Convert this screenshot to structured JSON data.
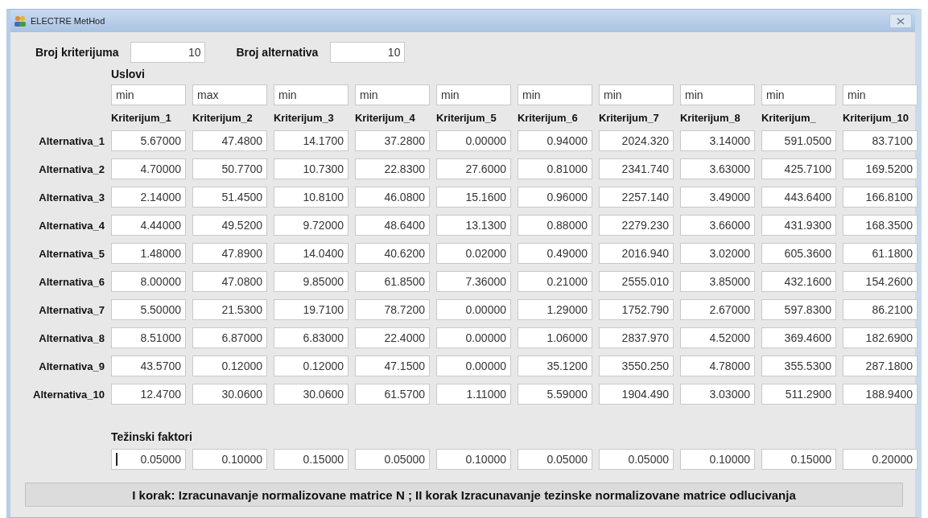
{
  "window": {
    "title": "ELECTRE MetHod"
  },
  "counts": [
    {
      "label": "Broj kriterijuma",
      "value": "10"
    },
    {
      "label": "Broj alternativa",
      "value": "10"
    }
  ],
  "conditions_label": "Uslovi",
  "conditions": [
    "min",
    "max",
    "min",
    "min",
    "min",
    "min",
    "min",
    "min",
    "min",
    "min"
  ],
  "criteria": [
    "Kriterijum_1",
    "Kriterijum_2",
    "Kriterijum_3",
    "Kriterijum_4",
    "Kriterijum_5",
    "Kriterijum_6",
    "Kriterijum_7",
    "Kriterijum_8",
    "Kriterijum_",
    "Kriterijum_10"
  ],
  "rows": [
    {
      "label": "Alternativa_1",
      "values": [
        "5.67000",
        "47.4800",
        "14.1700",
        "37.2800",
        "0.00000",
        "0.94000",
        "2024.320",
        "3.14000",
        "591.0500",
        "83.7100"
      ]
    },
    {
      "label": "Alternativa_2",
      "values": [
        "4.70000",
        "50.7700",
        "10.7300",
        "22.8300",
        "27.6000",
        "0.81000",
        "2341.740",
        "3.63000",
        "425.7100",
        "169.5200"
      ]
    },
    {
      "label": "Alternativa_3",
      "values": [
        "2.14000",
        "51.4500",
        "10.8100",
        "46.0800",
        "15.1600",
        "0.96000",
        "2257.140",
        "3.49000",
        "443.6400",
        "166.8100"
      ]
    },
    {
      "label": "Alternativa_4",
      "values": [
        "4.44000",
        "49.5200",
        "9.72000",
        "48.6400",
        "13.1300",
        "0.88000",
        "2279.230",
        "3.66000",
        "431.9300",
        "168.3500"
      ]
    },
    {
      "label": "Alternativa_5",
      "values": [
        "1.48000",
        "47.8900",
        "14.0400",
        "40.6200",
        "0.02000",
        "0.49000",
        "2016.940",
        "3.02000",
        "605.3600",
        "61.1800"
      ]
    },
    {
      "label": "Alternativa_6",
      "values": [
        "8.00000",
        "47.0800",
        "9.85000",
        "61.8500",
        "7.36000",
        "0.21000",
        "2555.010",
        "3.85000",
        "432.1600",
        "154.2600"
      ]
    },
    {
      "label": "Alternativa_7",
      "values": [
        "5.50000",
        "21.5300",
        "19.7100",
        "78.7200",
        "0.00000",
        "1.29000",
        "1752.790",
        "2.67000",
        "597.8300",
        "86.2100"
      ]
    },
    {
      "label": "Alternativa_8",
      "values": [
        "8.51000",
        "6.87000",
        "6.83000",
        "22.4000",
        "0.00000",
        "1.06000",
        "2837.970",
        "4.52000",
        "369.4600",
        "182.6900"
      ]
    },
    {
      "label": "Alternativa_9",
      "values": [
        "43.5700",
        "0.12000",
        "0.12000",
        "47.1500",
        "0.00000",
        "35.1200",
        "3550.250",
        "4.78000",
        "355.5300",
        "287.1800"
      ]
    },
    {
      "label": "Alternativa_10",
      "values": [
        "12.4700",
        "30.0600",
        "30.0600",
        "61.5700",
        "1.11000",
        "5.59000",
        "1904.490",
        "3.03000",
        "511.2900",
        "188.9400"
      ]
    }
  ],
  "weights_label": "Težinski faktori",
  "weights": [
    {
      "value": "0.05000",
      "focused": true
    },
    {
      "value": "0.10000",
      "focused": false
    },
    {
      "value": "0.15000",
      "focused": false
    },
    {
      "value": "0.05000",
      "focused": false
    },
    {
      "value": "0.10000",
      "focused": false
    },
    {
      "value": "0.05000",
      "focused": false
    },
    {
      "value": "0.05000",
      "focused": false
    },
    {
      "value": "0.10000",
      "focused": false
    },
    {
      "value": "0.15000",
      "focused": false
    },
    {
      "value": "0.20000",
      "focused": false
    }
  ],
  "action_button": "I korak: Izracunavanje normalizovane matrice N ; II korak Izracunavanje tezinske normalizovane matrice odlucivanja"
}
